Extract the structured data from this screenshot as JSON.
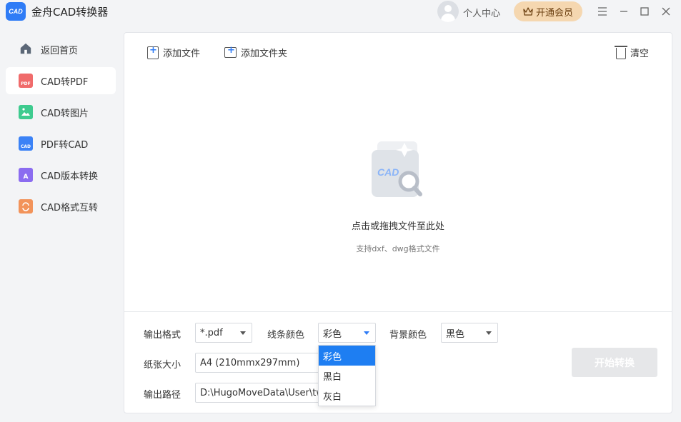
{
  "app": {
    "logo_text": "CAD",
    "title": "金舟CAD转换器",
    "user_center": "个人中心",
    "vip_label": "开通会员",
    "window_controls": [
      "menu-icon",
      "minimize-icon",
      "maximize-icon",
      "close-icon"
    ]
  },
  "sidebar": {
    "items": [
      {
        "label": "返回首页",
        "icon": "home-icon",
        "active": false
      },
      {
        "label": "CAD转PDF",
        "icon": "pdf-icon",
        "icon_text": "PDF",
        "color": "#f06b6b",
        "active": true
      },
      {
        "label": "CAD转图片",
        "icon": "image-icon",
        "icon_text": "",
        "color": "#3ecb8f",
        "active": false
      },
      {
        "label": "PDF转CAD",
        "icon": "cad-icon",
        "icon_text": "CAD",
        "color": "#3b82f6",
        "active": false
      },
      {
        "label": "CAD版本转换",
        "icon": "version-icon",
        "icon_text": "A",
        "color": "#8b6cf0",
        "active": false
      },
      {
        "label": "CAD格式互转",
        "icon": "format-icon",
        "icon_text": "",
        "color": "#f2935a",
        "active": false
      }
    ]
  },
  "toolbar": {
    "add_file": "添加文件",
    "add_folder": "添加文件夹",
    "clear": "清空"
  },
  "drop_zone": {
    "illustration_text": "CAD",
    "title": "点击或拖拽文件至此处",
    "hint": "支持dxf、dwg格式文件"
  },
  "options": {
    "output_format_label": "输出格式",
    "output_format_value": "*.pdf",
    "line_color_label": "线条颜色",
    "line_color_value": "彩色",
    "bg_color_label": "背景颜色",
    "bg_color_value": "黑色",
    "paper_size_label": "纸张大小",
    "paper_size_value": "A4 (210mmx297mm)",
    "output_path_label": "输出路径",
    "output_path_value": "D:\\HugoMoveData\\User\\tw",
    "line_color_options": [
      "彩色",
      "黑白",
      "灰白"
    ]
  },
  "start_button": "开始转换",
  "colors": {
    "accent": "#1e7ef2",
    "vip_bg": "#f5d7b0",
    "disabled_button": "#e6e7e9"
  }
}
